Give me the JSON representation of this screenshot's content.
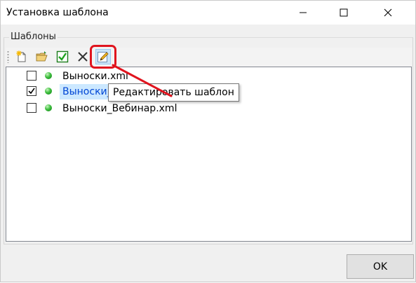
{
  "window": {
    "title": "Установка шаблона",
    "title_buttons": [
      "minimize-icon",
      "maximize-icon",
      "close-icon"
    ]
  },
  "group": {
    "label": "Шаблоны"
  },
  "toolbar": {
    "buttons": [
      {
        "icon": "new-document-icon"
      },
      {
        "icon": "open-folder-icon"
      },
      {
        "icon": "checkmark-icon"
      },
      {
        "icon": "delete-x-icon"
      },
      {
        "icon": "edit-pencil-icon",
        "state": "hover"
      }
    ]
  },
  "tooltip": {
    "text": "Редактировать шаблон"
  },
  "templates": [
    {
      "name": "Выноски.xml",
      "checked": false,
      "status": "green"
    },
    {
      "name": "Выноски_",
      "checked": true,
      "status": "green",
      "selected": true
    },
    {
      "name": "Выноски_Вебинар.xml",
      "checked": false,
      "status": "green"
    }
  ],
  "footer": {
    "ok_label": "OK"
  },
  "colors": {
    "annotation": "#e0141e",
    "selection": "#cce8ff",
    "selected_text": "#0046d5",
    "status_green": "#2fb52f"
  }
}
